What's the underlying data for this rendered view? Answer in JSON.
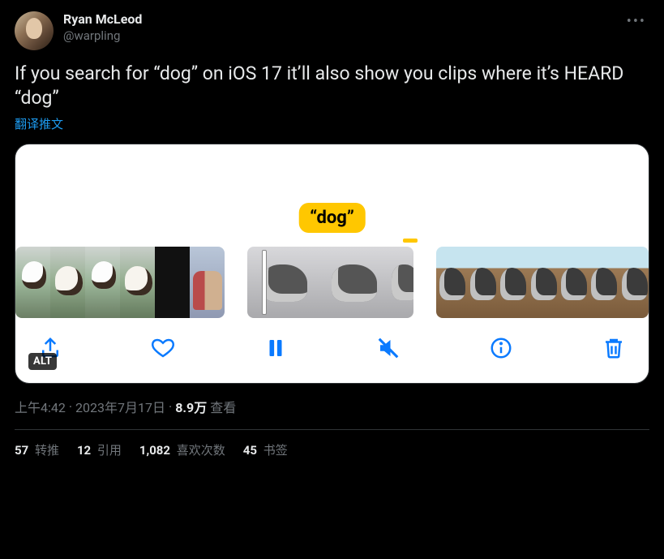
{
  "author": {
    "display_name": "Ryan McLeod",
    "handle": "@warpling"
  },
  "more_label": "•••",
  "body_text": "If you search for “dog” on iOS 17 it’ll also show you clips where it’s HEARD “dog”",
  "translate_label": "翻译推文",
  "media": {
    "caption": "“dog”",
    "alt_badge": "ALT",
    "toolbar": {
      "share": "share",
      "like": "like",
      "pause": "pause",
      "mute": "mute",
      "info": "info",
      "delete": "delete"
    }
  },
  "meta": {
    "time": "上午4:42",
    "dot1": " · ",
    "date": "2023年7月17日",
    "dot2": " · ",
    "views_value": "8.9万",
    "views_label": " 查看"
  },
  "stats": {
    "retweets": {
      "value": "57",
      "label": " 转推"
    },
    "quotes": {
      "value": "12",
      "label": " 引用"
    },
    "likes": {
      "value": "1,082",
      "label": " 喜欢次数"
    },
    "bookmarks": {
      "value": "45",
      "label": " 书签"
    }
  }
}
